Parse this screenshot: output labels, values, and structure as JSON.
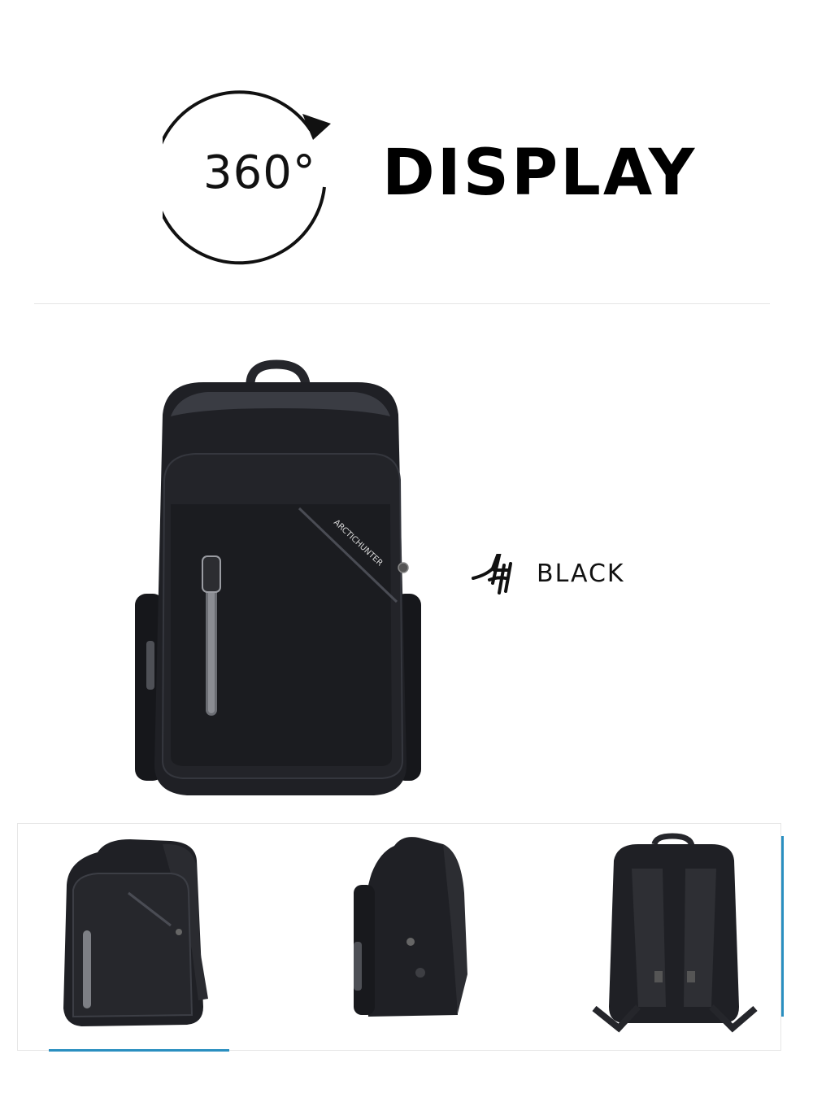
{
  "header": {
    "rotation_label": "360°",
    "title": "DISPLAY"
  },
  "product": {
    "brand_print": "ARCTICHUNTER",
    "color_name": "BLACK"
  },
  "gallery": {
    "views": [
      "front-angle",
      "side",
      "back"
    ],
    "selected_index": 0
  },
  "colors": {
    "accent": "#2a8fc0",
    "bag": "#1c1d22",
    "text": "#111111"
  }
}
